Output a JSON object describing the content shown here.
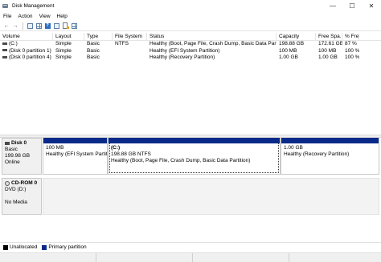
{
  "window": {
    "title": "Disk Management",
    "minimize": "—",
    "maximize": "☐",
    "close": "✕"
  },
  "menu": [
    "File",
    "Action",
    "View",
    "Help"
  ],
  "toolbar": {
    "buttons": [
      "back-icon",
      "forward-icon",
      "console-tree-icon",
      "properties-icon",
      "help-icon",
      "rescan-icon",
      "settings-icon"
    ]
  },
  "volumes": {
    "columns": [
      "Volume",
      "Layout",
      "Type",
      "File System",
      "Status",
      "Capacity",
      "Free Spa...",
      "% Free"
    ],
    "rows": [
      [
        "(C:)",
        "Simple",
        "Basic",
        "NTFS",
        "Healthy (Boot, Page File, Crash Dump, Basic Data Partition)",
        "198.88 GB",
        "172.61 GB",
        "87 %"
      ],
      [
        "(Disk 0 partition 1)",
        "Simple",
        "Basic",
        "",
        "Healthy (EFI System Partition)",
        "100 MB",
        "100 MB",
        "100 %"
      ],
      [
        "(Disk 0 partition 4)",
        "Simple",
        "Basic",
        "",
        "Healthy (Recovery Partition)",
        "1.00 GB",
        "1.00 GB",
        "100 %"
      ]
    ]
  },
  "disks": [
    {
      "name": "Disk 0",
      "type": "Basic",
      "size": "199.98 GB",
      "state": "Online",
      "partitions": [
        {
          "name": "",
          "size": "100 MB",
          "status": "Healthy (EFI System Partitio"
        },
        {
          "name": "(C:)",
          "size": "198.88 GB NTFS",
          "status": "Healthy (Boot, Page File, Crash Dump, Basic Data Partition)"
        },
        {
          "name": "",
          "size": "1.00 GB",
          "status": "Healthy (Recovery Partition)"
        }
      ]
    },
    {
      "name": "CD-ROM 0",
      "type": "DVD (D:)",
      "state": "No Media"
    }
  ],
  "legend": [
    {
      "label": "Unallocated",
      "color": "#000000"
    },
    {
      "label": "Primary partition",
      "color": "#0a2a8a"
    }
  ],
  "colors": {
    "primary_partition": "#0a2a8a",
    "unallocated": "#000000"
  }
}
